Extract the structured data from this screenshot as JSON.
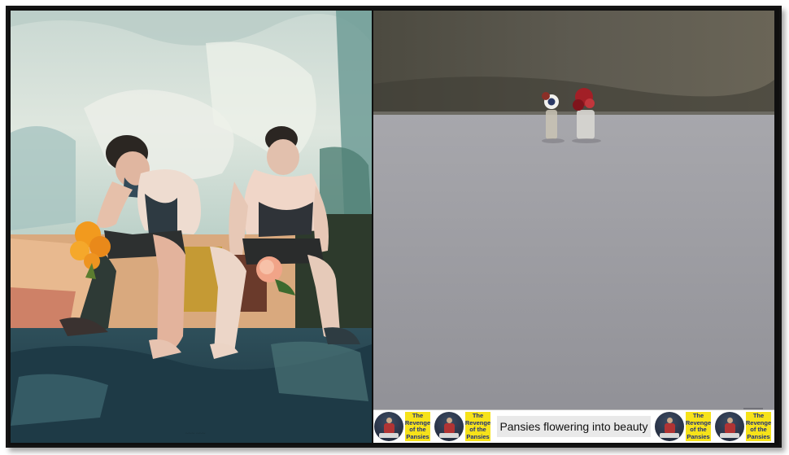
{
  "banner": {
    "caption": "Pansies flowering into beauty",
    "logo_line1": "The",
    "logo_line2": "Revenge",
    "logo_line3": "of the",
    "logo_line4": "Pansies"
  },
  "colors": {
    "frame": "#141414",
    "logo_yellow": "#f6e21a",
    "logo_text": "#1f2f7a",
    "caption_bg": "#e9e9e9"
  }
}
